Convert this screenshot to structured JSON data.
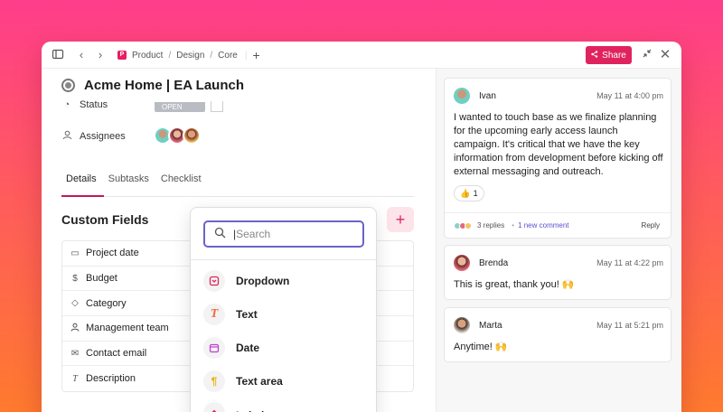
{
  "breadcrumb": {
    "workspace_initial": "P",
    "items": [
      "Product",
      "Design",
      "Core"
    ]
  },
  "share_label": "Share",
  "task": {
    "title": "Acme Home | EA Launch",
    "status_label": "Status",
    "status_value": "OPEN",
    "assignees_label": "Assignees"
  },
  "tabs": [
    "Details",
    "Subtasks",
    "Checklist"
  ],
  "custom_fields": {
    "title": "Custom Fields",
    "rows": [
      "Project date",
      "Budget",
      "Category",
      "Management team",
      "Contact email",
      "Description"
    ]
  },
  "dropdown": {
    "search_placeholder": "Search",
    "options": [
      "Dropdown",
      "Text",
      "Date",
      "Text area",
      "Label"
    ]
  },
  "comments": [
    {
      "author": "Ivan",
      "time": "May 11 at 4:00 pm",
      "text": "I wanted to touch base as we finalize planning for the upcoming early access launch campaign. It's critical that we have the key information from development before kicking off external messaging and outreach.",
      "reaction_count": "1",
      "replies": "3 replies",
      "new_comment": "1 new comment",
      "reply_label": "Reply"
    },
    {
      "author": "Brenda",
      "time": "May 11 at 4:22 pm",
      "text": "This is great, thank you! 🙌"
    },
    {
      "author": "Marta",
      "time": "May 11 at 5:21 pm",
      "text": "Anytime! 🙌"
    }
  ],
  "colors": {
    "accent": "#e0235f",
    "search_focus": "#6b63c9",
    "link": "#5b4fcf"
  }
}
